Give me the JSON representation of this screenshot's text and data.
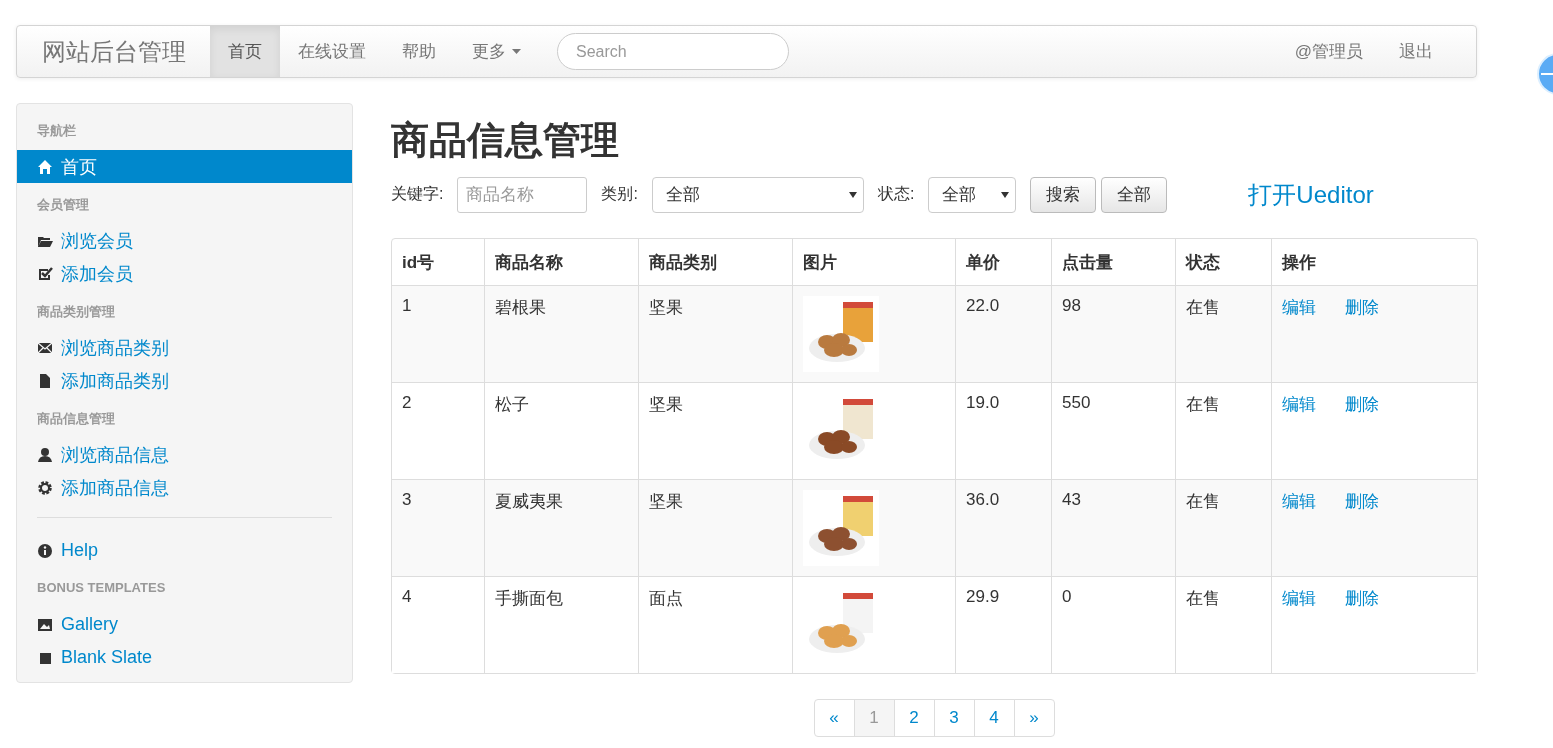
{
  "navbar": {
    "brand": "网站后台管理",
    "items": [
      {
        "label": "首页",
        "selected": true
      },
      {
        "label": "在线设置",
        "selected": false
      },
      {
        "label": "帮助",
        "selected": false
      },
      {
        "label": "更多",
        "selected": false,
        "kind": "dropdown"
      }
    ],
    "search": {
      "placeholder": "Search"
    },
    "right_items": [
      "@管理员",
      "退出"
    ]
  },
  "sidebar": {
    "sections": [
      {
        "header": "导航栏",
        "items": [
          {
            "label": "首页",
            "selected": true
          }
        ]
      },
      {
        "header": "会员管理",
        "items": [
          {
            "label": "浏览会员",
            "selected": false
          },
          {
            "label": "添加会员",
            "selected": false
          }
        ]
      },
      {
        "header": "商品类别管理",
        "items": [
          {
            "label": "浏览商品类别",
            "selected": false
          },
          {
            "label": "添加商品类别",
            "selected": false
          }
        ]
      },
      {
        "header": "商品信息管理",
        "items": [
          {
            "label": "浏览商品信息",
            "selected": false
          },
          {
            "label": "添加商品信息",
            "selected": false
          }
        ]
      },
      {
        "kind": "divider",
        "items": [
          {
            "label": "Help",
            "selected": false
          }
        ]
      },
      {
        "header": "BONUS TEMPLATES",
        "items": [
          {
            "label": "Gallery",
            "selected": false
          },
          {
            "label": "Blank Slate",
            "selected": false
          }
        ]
      }
    ]
  },
  "page": {
    "title": "商品信息管理",
    "filters": {
      "keyword_label": "关键字:",
      "keyword_placeholder": "商品名称",
      "category_label": "类别:",
      "category_value": "全部",
      "status_label": "状态:",
      "status_value": "全部",
      "buttons": [
        "搜索",
        "全部"
      ],
      "link": "打开Ueditor"
    }
  },
  "table": {
    "columns": [
      "id号",
      "商品名称",
      "商品类别",
      "图片",
      "单价",
      "点击量",
      "状态",
      "操作"
    ],
    "rows": [
      {
        "id": "1",
        "name": "碧根果",
        "category": "坚果",
        "price": "22.0",
        "clicks": "98",
        "status": "在售",
        "actions": [
          "编辑",
          "删除"
        ]
      },
      {
        "id": "2",
        "name": "松子",
        "category": "坚果",
        "price": "19.0",
        "clicks": "550",
        "status": "在售",
        "actions": [
          "编辑",
          "删除"
        ]
      },
      {
        "id": "3",
        "name": "夏威夷果",
        "category": "坚果",
        "price": "36.0",
        "clicks": "43",
        "status": "在售",
        "actions": [
          "编辑",
          "删除"
        ]
      },
      {
        "id": "4",
        "name": "手撕面包",
        "category": "面点",
        "price": "29.9",
        "clicks": "0",
        "status": "在售",
        "actions": [
          "编辑",
          "删除"
        ]
      }
    ]
  },
  "pagination": [
    {
      "label": "«",
      "selected": false
    },
    {
      "label": "1",
      "selected": true
    },
    {
      "label": "2",
      "selected": false
    },
    {
      "label": "3",
      "selected": false
    },
    {
      "label": "4",
      "selected": false
    },
    {
      "label": "»",
      "selected": false
    }
  ]
}
